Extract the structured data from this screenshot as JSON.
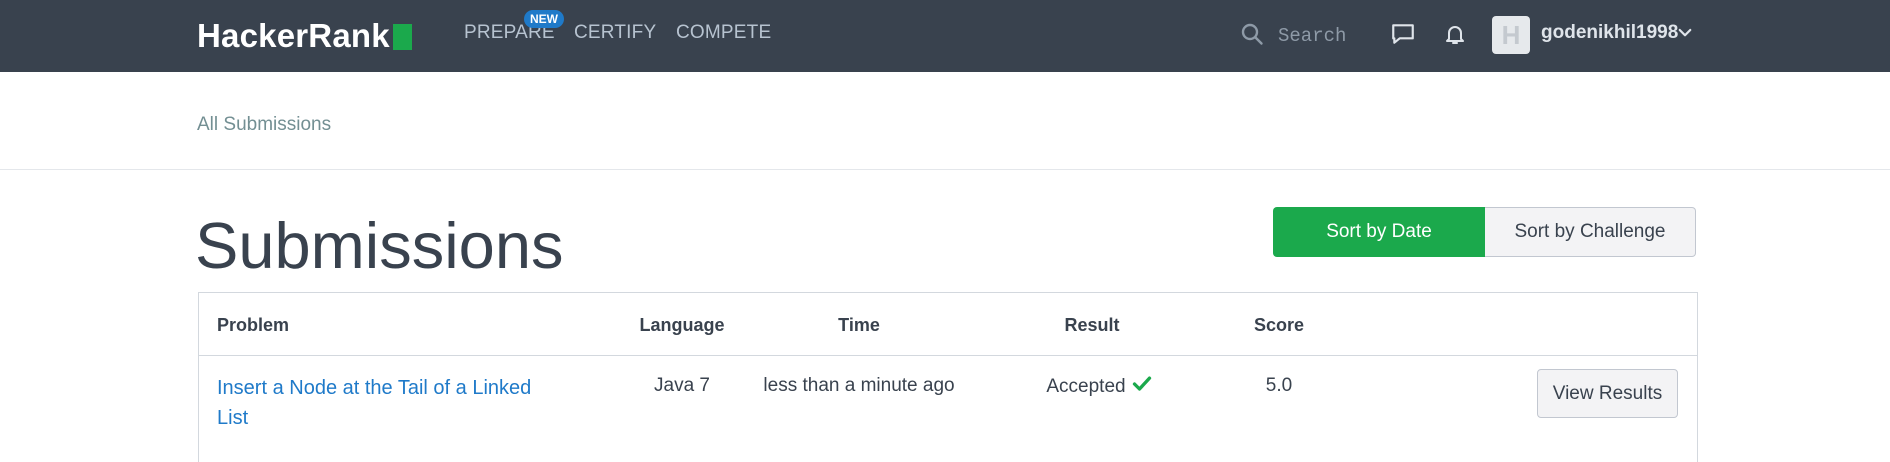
{
  "header": {
    "logo_text": "HackerRank",
    "nav": {
      "prepare": "PREPARE",
      "prepare_badge": "NEW",
      "certify": "CERTIFY",
      "compete": "COMPETE"
    },
    "search": {
      "placeholder": "Search",
      "icon": "search-icon"
    },
    "chat_icon": "chat-icon",
    "bell_icon": "bell-icon",
    "avatar_letter": "H",
    "username": "godenikhil1998",
    "user_menu_icon": "chevron-down-icon"
  },
  "breadcrumb": {
    "label": "All Submissions"
  },
  "page": {
    "title": "Submissions"
  },
  "sort": {
    "by_date": "Sort by Date",
    "by_challenge": "Sort by Challenge",
    "active": "by_date"
  },
  "table": {
    "headers": {
      "problem": "Problem",
      "language": "Language",
      "time": "Time",
      "result": "Result",
      "score": "Score"
    },
    "rows": [
      {
        "problem": "Insert a Node at the Tail of a Linked List",
        "language": "Java 7",
        "time": "less than a minute ago",
        "result": "Accepted",
        "result_icon": "check-icon",
        "score": "5.0",
        "action": "View Results"
      }
    ]
  },
  "colors": {
    "topbar": "#39424e",
    "accent_green": "#1ba94c",
    "link_blue": "#1f7ac9",
    "text_dark": "#39424e"
  }
}
